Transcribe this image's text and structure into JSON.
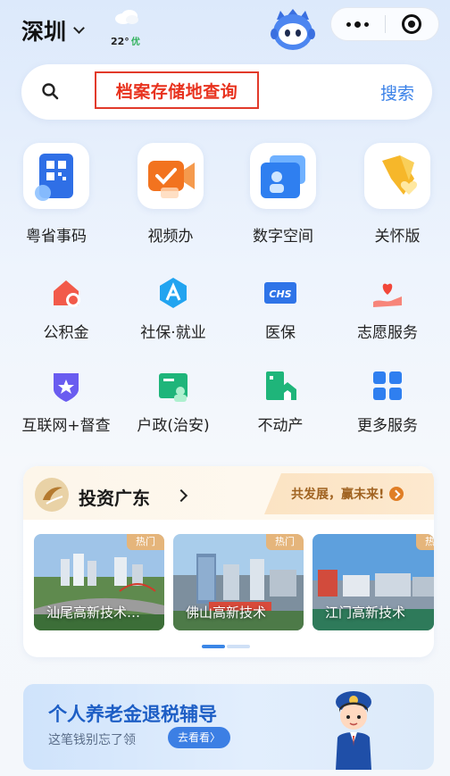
{
  "header": {
    "city": "深圳",
    "temperature": "22°",
    "aqi": "优"
  },
  "search": {
    "query": "档案存储地查询",
    "button": "搜索"
  },
  "big_services": [
    {
      "label": "粤省事码",
      "icon": "qr-code-card-icon"
    },
    {
      "label": "视频办",
      "icon": "video-camera-icon"
    },
    {
      "label": "数字空间",
      "icon": "digital-space-icon"
    },
    {
      "label": "关怀版",
      "icon": "care-ribbon-icon"
    }
  ],
  "services_row1": [
    {
      "label": "公积金",
      "icon": "housing-fund-icon"
    },
    {
      "label": "社保·就业",
      "icon": "social-security-icon"
    },
    {
      "label": "医保",
      "icon": "chs-medical-insurance-icon"
    },
    {
      "label": "志愿服务",
      "icon": "volunteer-heart-icon"
    }
  ],
  "services_row2": [
    {
      "label": "互联网+督查",
      "icon": "shield-star-icon"
    },
    {
      "label": "户政(治安)",
      "icon": "household-id-icon"
    },
    {
      "label": "不动产",
      "icon": "real-estate-icon"
    },
    {
      "label": "更多服务",
      "icon": "more-grid-icon"
    }
  ],
  "invest": {
    "title": "投资广东",
    "slogan": "共发展，赢未来!",
    "cards": [
      {
        "label": "汕尾高新技术…",
        "tag": "热门"
      },
      {
        "label": "佛山高新技术",
        "tag": "热门"
      },
      {
        "label": "江门高新技术",
        "tag": "热门"
      }
    ]
  },
  "banner": {
    "title": "个人养老金退税辅导",
    "subtitle": "这笔钱别忘了领",
    "button": "去看看〉"
  },
  "colors": {
    "accent": "#3b82e8",
    "search_highlight": "#e8321e",
    "banner_title": "#1d5ec5"
  }
}
